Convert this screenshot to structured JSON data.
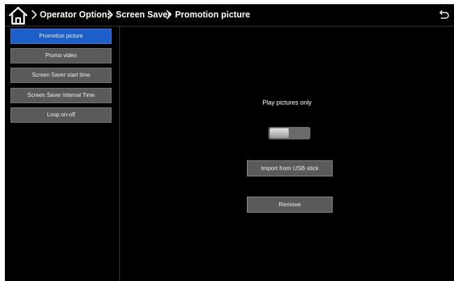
{
  "breadcrumb": {
    "items": [
      "Operator Options",
      "Screen Saver",
      "Promotion picture"
    ]
  },
  "icons": {
    "home": "home-icon",
    "separator": "chevron-right-icon",
    "back": "back-arrow-icon"
  },
  "sidebar": {
    "items": [
      {
        "label": "Promotion picture",
        "active": true
      },
      {
        "label": "Promo video",
        "active": false
      },
      {
        "label": "Screen Saver start time",
        "active": false
      },
      {
        "label": "Screen Saver Interval Time",
        "active": false
      },
      {
        "label": "Loop on-off",
        "active": false
      }
    ]
  },
  "main": {
    "mode_label": "Play pictures only",
    "toggle_state": "off",
    "import_label": "Import from USB stick",
    "remove_label": "Remove"
  },
  "colors": {
    "background": "#000000",
    "active_item": "#1d5ec9",
    "button": "#5a5a5a"
  }
}
